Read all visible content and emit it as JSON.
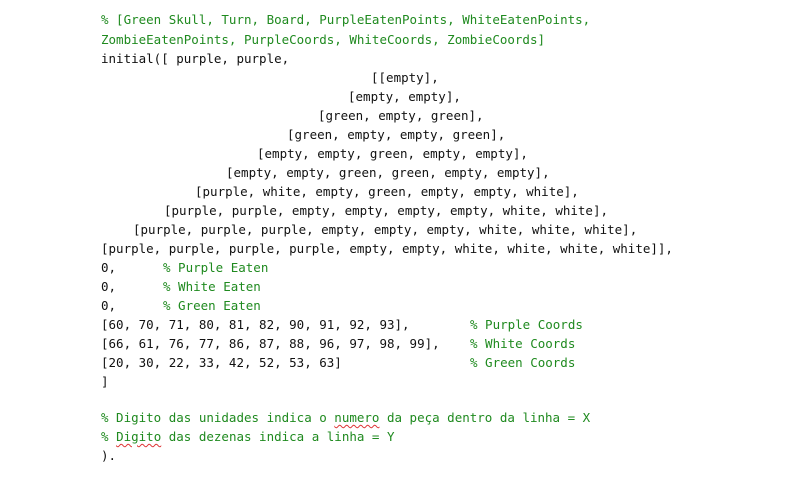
{
  "header_comment": {
    "line1": "% [Green Skull, Turn, Board, PurpleEatenPoints, WhiteEatenPoints,",
    "line2": "ZombieEatenPoints, PurpleCoords, WhiteCoords, ZombieCoords]"
  },
  "initial_line": "initial([ purple, purple,",
  "board_rows": [
    "[[empty],",
    "[empty, empty],",
    "[green, empty, green],",
    "[green, empty, empty, green],",
    "[empty, empty, green, empty, empty],",
    "[empty, empty, green, green, empty, empty],",
    "[purple, white, empty, green, empty, empty, white],",
    "[purple, purple, empty, empty, empty, empty, white, white],",
    "[purple, purple, purple, empty, empty, empty, white, white, white],",
    "[purple, purple, purple, purple, empty, empty, white, white, white, white]],"
  ],
  "counters": [
    {
      "code": "0,",
      "comment": "% Purple Eaten"
    },
    {
      "code": "0,",
      "comment": "% White Eaten"
    },
    {
      "code": "0,",
      "comment": "% Green Eaten"
    }
  ],
  "coords": [
    {
      "code": "[60, 70, 71, 80, 81, 82, 90, 91, 92, 93],",
      "comment": "% Purple Coords"
    },
    {
      "code": "[66, 61, 76, 77, 86, 87, 88, 96, 97, 98, 99],",
      "comment": "% White Coords"
    },
    {
      "code": "[20, 30, 22, 33, 42, 52, 53, 63]",
      "comment": "% Green Coords"
    }
  ],
  "close_bracket": "]",
  "footer_comments": {
    "line1": {
      "a": "% Digito das unidades indica o ",
      "squiggle": "numero",
      "b": " da peça dentro da linha = X"
    },
    "line2": {
      "a": "% ",
      "squiggle": "Digito",
      "b": " das dezenas indica a linha = Y"
    }
  },
  "end_line": ")."
}
